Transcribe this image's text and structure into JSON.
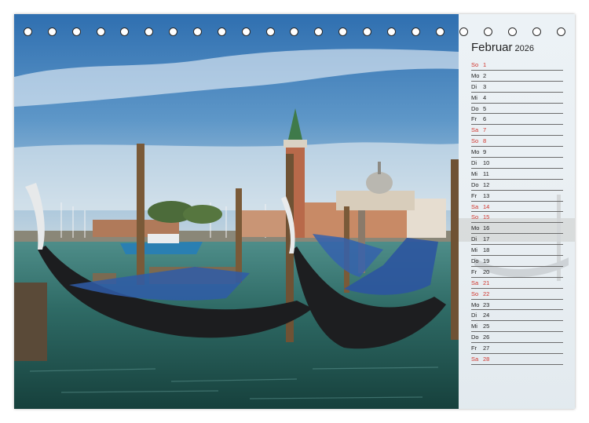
{
  "calendar": {
    "month": "Februar",
    "year": "2026",
    "weekend_color": "#d0342c",
    "days": [
      {
        "wd": "So",
        "d": "1",
        "we": true
      },
      {
        "wd": "Mo",
        "d": "2",
        "we": false
      },
      {
        "wd": "Di",
        "d": "3",
        "we": false
      },
      {
        "wd": "Mi",
        "d": "4",
        "we": false
      },
      {
        "wd": "Do",
        "d": "5",
        "we": false
      },
      {
        "wd": "Fr",
        "d": "6",
        "we": false
      },
      {
        "wd": "Sa",
        "d": "7",
        "we": true
      },
      {
        "wd": "So",
        "d": "8",
        "we": true
      },
      {
        "wd": "Mo",
        "d": "9",
        "we": false
      },
      {
        "wd": "Di",
        "d": "10",
        "we": false
      },
      {
        "wd": "Mi",
        "d": "11",
        "we": false
      },
      {
        "wd": "Do",
        "d": "12",
        "we": false
      },
      {
        "wd": "Fr",
        "d": "13",
        "we": false
      },
      {
        "wd": "Sa",
        "d": "14",
        "we": true
      },
      {
        "wd": "So",
        "d": "15",
        "we": true
      },
      {
        "wd": "Mo",
        "d": "16",
        "we": false
      },
      {
        "wd": "Di",
        "d": "17",
        "we": false
      },
      {
        "wd": "Mi",
        "d": "18",
        "we": false
      },
      {
        "wd": "Do",
        "d": "19",
        "we": false
      },
      {
        "wd": "Fr",
        "d": "20",
        "we": false
      },
      {
        "wd": "Sa",
        "d": "21",
        "we": true
      },
      {
        "wd": "So",
        "d": "22",
        "we": true
      },
      {
        "wd": "Mo",
        "d": "23",
        "we": false
      },
      {
        "wd": "Di",
        "d": "24",
        "we": false
      },
      {
        "wd": "Mi",
        "d": "25",
        "we": false
      },
      {
        "wd": "Do",
        "d": "26",
        "we": false
      },
      {
        "wd": "Fr",
        "d": "27",
        "we": false
      },
      {
        "wd": "Sa",
        "d": "28",
        "we": true
      }
    ]
  }
}
